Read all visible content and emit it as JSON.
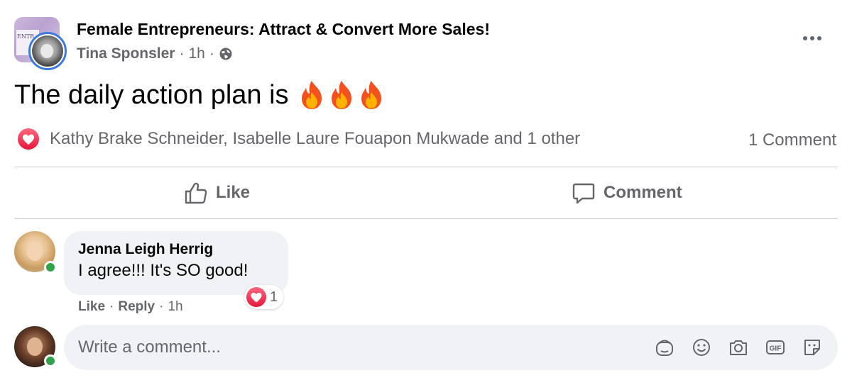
{
  "post": {
    "group_name": "Female Entrepreneurs: Attract & Convert More Sales!",
    "author": "Tina Sponsler",
    "time": "1h",
    "separator": "·",
    "privacy_icon": "globe-icon",
    "group_avatar_text": "ENTR",
    "text": "The daily action plan is",
    "emoji": [
      "fire-icon",
      "fire-icon",
      "fire-icon"
    ]
  },
  "reactions": {
    "icon": "love-icon",
    "summary": "Kathy Brake Schneider, Isabelle Laure Fouapon Mukwade and 1 other",
    "comment_count": "1 Comment"
  },
  "actions": {
    "like": "Like",
    "comment": "Comment"
  },
  "comments": [
    {
      "author": "Jenna Leigh Herrig",
      "text": "I agree!!! It's SO good!",
      "reaction_count": "1",
      "like_label": "Like",
      "reply_label": "Reply",
      "time": "1h",
      "separator": "·"
    }
  ],
  "composer": {
    "placeholder": "Write a comment...",
    "icons": [
      "avatar-sticker-icon",
      "emoji-icon",
      "camera-icon",
      "gif-icon",
      "sticker-icon"
    ]
  },
  "colors": {
    "secondary_text": "#65676b",
    "bubble": "#f0f2f5",
    "love": "#f33e58",
    "online": "#31a24c",
    "avatar_ring": "#3b7be0"
  }
}
